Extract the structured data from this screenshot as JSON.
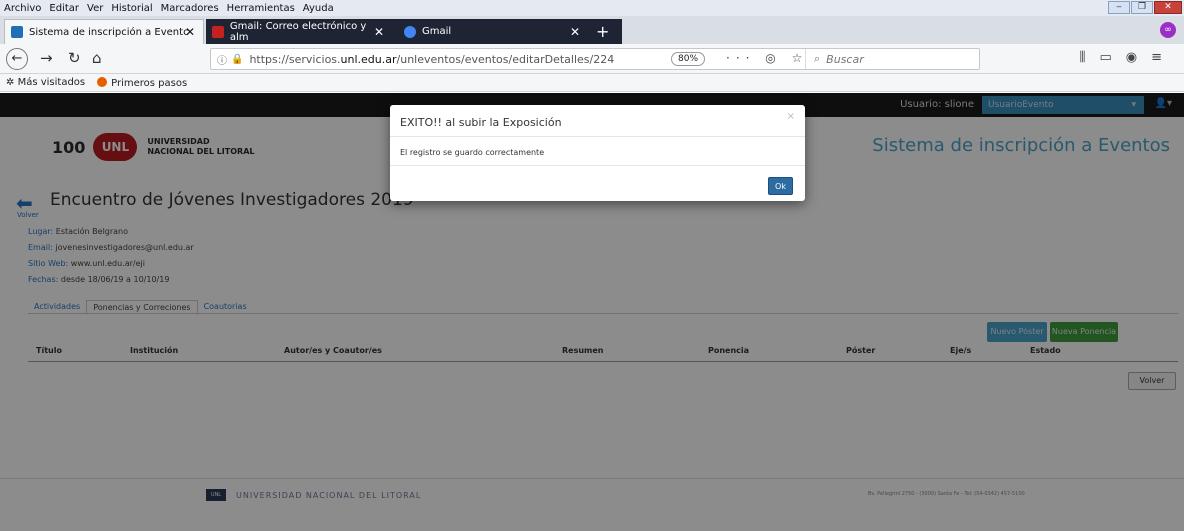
{
  "menubar": {
    "items": [
      "Archivo",
      "Editar",
      "Ver",
      "Historial",
      "Marcadores",
      "Herramientas",
      "Ayuda"
    ]
  },
  "browser": {
    "tabs": [
      {
        "label": "Sistema de inscripción a Eventc",
        "icon": "unl-favicon",
        "color": "#1f6fb5"
      },
      {
        "label": "Gmail: Correo electrónico y alm",
        "icon": "gmail-icon",
        "color": "#c5221f"
      },
      {
        "label": "Gmail",
        "icon": "google-icon",
        "color": "#4285f4"
      }
    ],
    "url_prefix": "https://servicios.",
    "url_domain": "unl.edu.ar",
    "url_path": "/unleventos/eventos/editarDetalles/224",
    "zoom": "80%",
    "search_placeholder": "Buscar",
    "bookmarks": [
      "Más visitados",
      "Primeros pasos"
    ]
  },
  "site": {
    "user_label": "Usuario: slione",
    "user_role": "UsuarioEvento",
    "logo_100": "100",
    "logo_unl": "UNL",
    "logo_name_1": "UNIVERSIDAD",
    "logo_name_2": "NACIONAL DEL LITORAL",
    "title": "Sistema de inscripción a Eventos"
  },
  "event": {
    "back_label": "Volver",
    "title": "Encuentro de Jóvenes Investigadores 2019",
    "lugar_key": "Lugar:",
    "lugar": "Estación Belgrano",
    "email_key": "Email:",
    "email": "jovenesinvestigadores@unl.edu.ar",
    "web_key": "Sitio Web:",
    "web": "www.unl.edu.ar/eji",
    "fechas_key": "Fechas:",
    "fechas": "desde 18/06/19 a 10/10/19"
  },
  "tabs": [
    "Actividades",
    "Ponencias y Correciones",
    "Coautorias"
  ],
  "buttons": {
    "nuevo_poster": "Nuevo Póster",
    "nueva_ponencia": "Nueva Ponencia",
    "volver": "Volver"
  },
  "table": {
    "columns": [
      "Título",
      "Institución",
      "Autor/es y Coautor/es",
      "Resumen",
      "Ponencia",
      "Póster",
      "Eje/s",
      "Estado"
    ]
  },
  "footer": {
    "logo": "UNL",
    "name": "UNIVERSIDAD NACIONAL DEL LITORAL",
    "address": "Bv. Pellegrini 2750 - (3000) Santa Fe - Tel: (54-0342) 457-5100"
  },
  "modal": {
    "title": "EXITO!! al subir la Exposición",
    "close": "×",
    "message": "El registro se guardo correctamente",
    "ok": "Ok"
  }
}
